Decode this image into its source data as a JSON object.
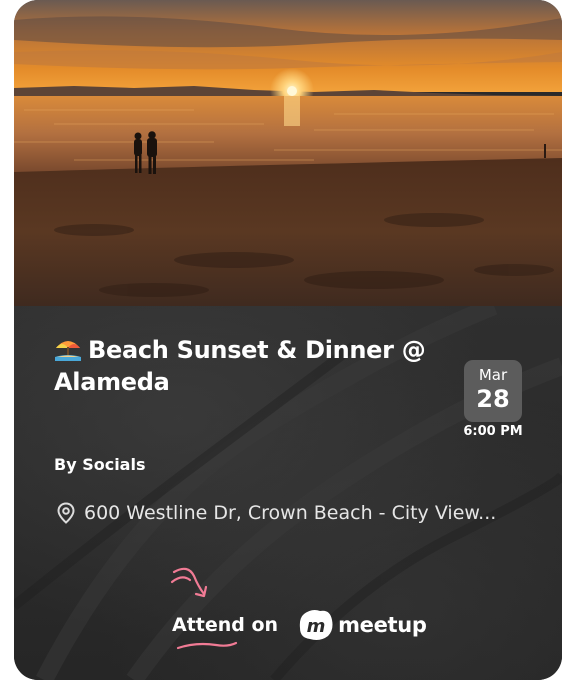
{
  "event": {
    "title": "Beach Sunset & Dinner @ Alameda",
    "title_emoji_icon": "beach-umbrella-icon",
    "date_month": "Mar",
    "date_day": "28",
    "time": "6:00 PM",
    "organizer": "By Socials",
    "location": "600 Westline Dr, Crown Beach - City View...",
    "location_icon": "map-pin-icon"
  },
  "cta": {
    "attend_label": "Attend on",
    "platform_name": "meetup",
    "platform_icon": "meetup-logo-icon",
    "accent_color": "#f17b95"
  },
  "colors": {
    "panel_bg": "#2a2a2a",
    "badge_bg": "#5c5c5c",
    "text": "#ffffff",
    "sky": "#e8902c",
    "sand": "#4a2e1c"
  }
}
